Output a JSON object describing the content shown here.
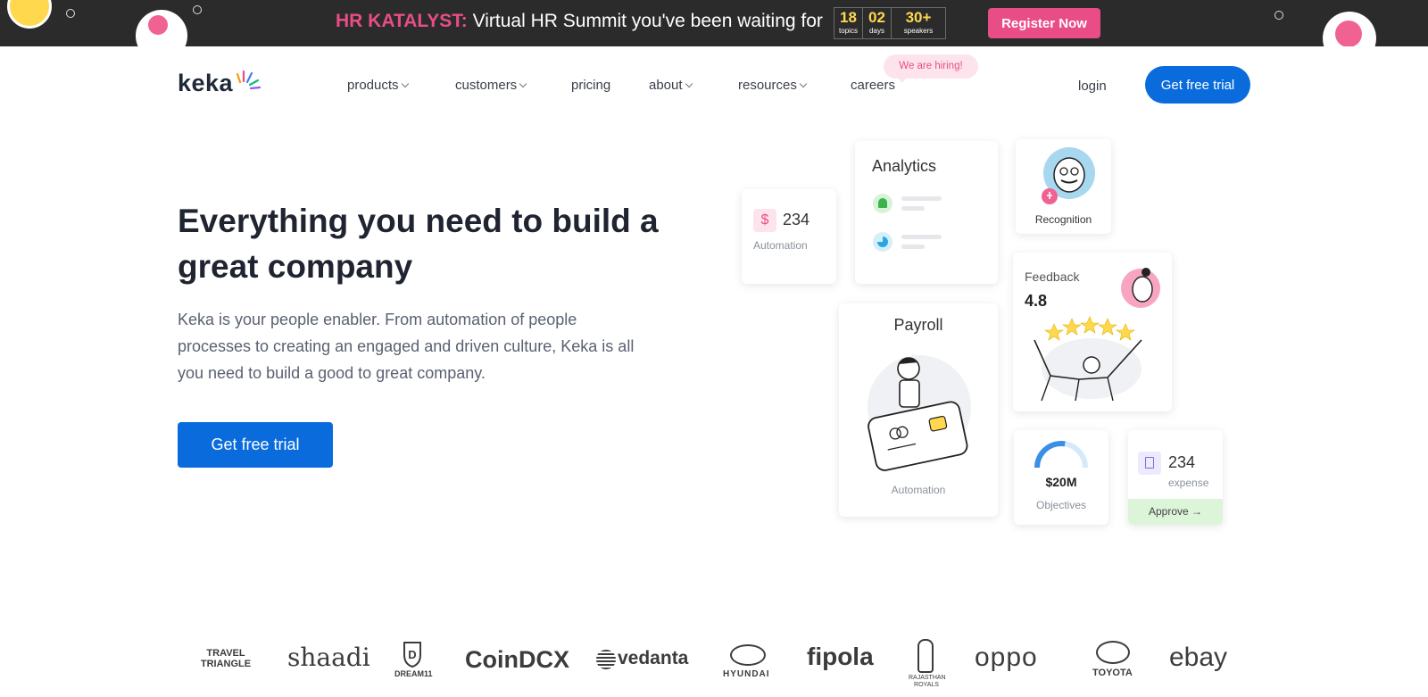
{
  "banner": {
    "highlight": "HR KATALYST:",
    "text": "Virtual HR Summit you've been waiting for",
    "counters": [
      {
        "value": "18",
        "label": "topics"
      },
      {
        "value": "02",
        "label": "days"
      },
      {
        "value": "30+",
        "label": "speakers"
      }
    ],
    "register_label": "Register Now"
  },
  "nav": {
    "logo": "keka",
    "items": [
      {
        "label": "products",
        "has_dropdown": true
      },
      {
        "label": "customers",
        "has_dropdown": true
      },
      {
        "label": "pricing",
        "has_dropdown": false
      },
      {
        "label": "about",
        "has_dropdown": true
      },
      {
        "label": "resources",
        "has_dropdown": true
      },
      {
        "label": "careers",
        "has_dropdown": false
      }
    ],
    "hiring_badge": "We are hiring!",
    "login": "login",
    "cta": "Get free trial"
  },
  "hero": {
    "title": "Everything you need to build a great company",
    "description": "Keka is your people enabler. From automation of people processes to creating an engaged and driven culture, Keka is all you need to build a good to great company.",
    "cta": "Get free trial"
  },
  "cards": {
    "automation": {
      "value": "234",
      "label": "Automation"
    },
    "analytics": {
      "title": "Analytics"
    },
    "recognition": {
      "label": "Recognition"
    },
    "payroll": {
      "title": "Payroll",
      "label": "Automation"
    },
    "feedback": {
      "title": "Feedback",
      "rating": "4.8"
    },
    "objectives": {
      "value": "$20M",
      "label": "Objectives",
      "progress": 0.55
    },
    "expense": {
      "value": "234",
      "label": "expense",
      "action": "Approve"
    }
  },
  "logos": [
    "TRAVEL TRIANGLE",
    "shaadi",
    "DREAM11",
    "CoinDCX",
    "vedanta",
    "HYUNDAI",
    "fipola",
    "RAJASTHAN ROYALS",
    "oppo",
    "TOYOTA",
    "ebay"
  ],
  "colors": {
    "banner_bg": "#2b2b2b",
    "accent_pink": "#e84d86",
    "accent_yellow": "#ffd84d",
    "primary_blue": "#0a6cdc"
  }
}
